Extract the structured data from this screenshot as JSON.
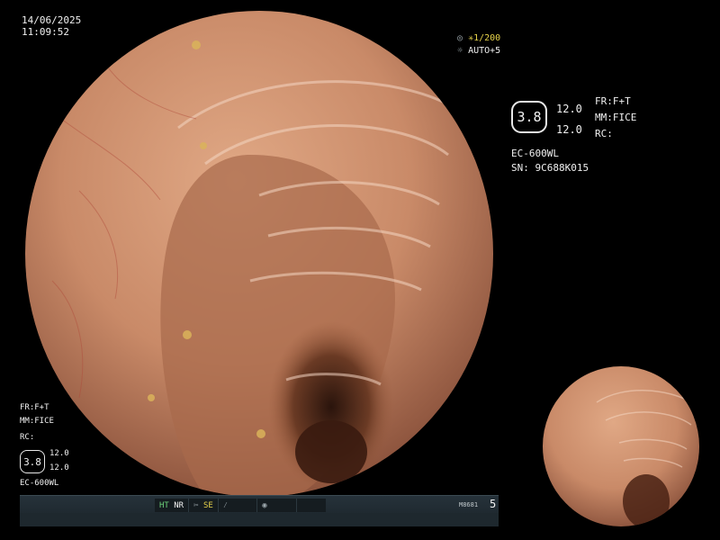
{
  "datetime": {
    "date": "14/06/2025",
    "time": "11:09:52"
  },
  "freeze": {
    "shutter": "1/200",
    "shutter_prefix": "✳",
    "auto": "AUTO+5"
  },
  "right_panel": {
    "badge": "3.8",
    "val1": "12.0",
    "val2": "12.0",
    "fr": "FR:F+T",
    "mm": "MM:FICE",
    "rc": "RC:",
    "model": "EC-600WL",
    "serial": "SN: 9C688K015"
  },
  "bottom_left": {
    "fr": "FR:F+T",
    "mm": "MM:FICE",
    "rc": "RC:",
    "badge": "3.8",
    "val1": "12.0",
    "val2": "12.0",
    "model": "EC-600WL"
  },
  "status_bar": {
    "ht": "HT",
    "nr": "NR",
    "se": "SE",
    "code": "M8681",
    "number": "5"
  },
  "colors": {
    "background": "#000000",
    "mucosa": "#c88a6a",
    "status_green": "#6cd17a",
    "status_yellow": "#e6d24a"
  }
}
